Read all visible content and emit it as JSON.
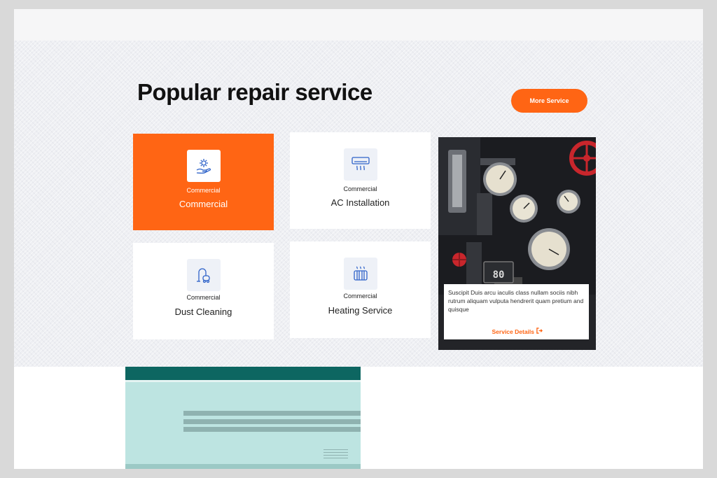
{
  "section": {
    "title": "Popular repair service",
    "more_button": "More Service"
  },
  "services": [
    {
      "category": "Commercial",
      "name": "Commercial",
      "icon": "gear-hand-icon",
      "active": true
    },
    {
      "category": "Commercial",
      "name": "AC Installation",
      "icon": "air-conditioner-icon",
      "active": false
    },
    {
      "category": "Commercial",
      "name": "Dust Cleaning",
      "icon": "vacuum-cleaner-icon",
      "active": false
    },
    {
      "category": "Commercial",
      "name": "Heating Service",
      "icon": "radiator-icon",
      "active": false
    }
  ],
  "feature": {
    "image": "steam-gauges-photo",
    "gauge_plate": "80",
    "description": "Suscipit Duis arcu iaculis class nullam sociis nibh rutrum aliquam vulputa hendrerit quam pretium and quisque",
    "link_label": "Service Details",
    "link_icon": "arrow-right-from-bracket-icon"
  },
  "colors": {
    "accent": "#ff6514",
    "icon_blue": "#2f63c9",
    "teal_dark": "#0d6661",
    "teal_light": "#bde4e1"
  }
}
